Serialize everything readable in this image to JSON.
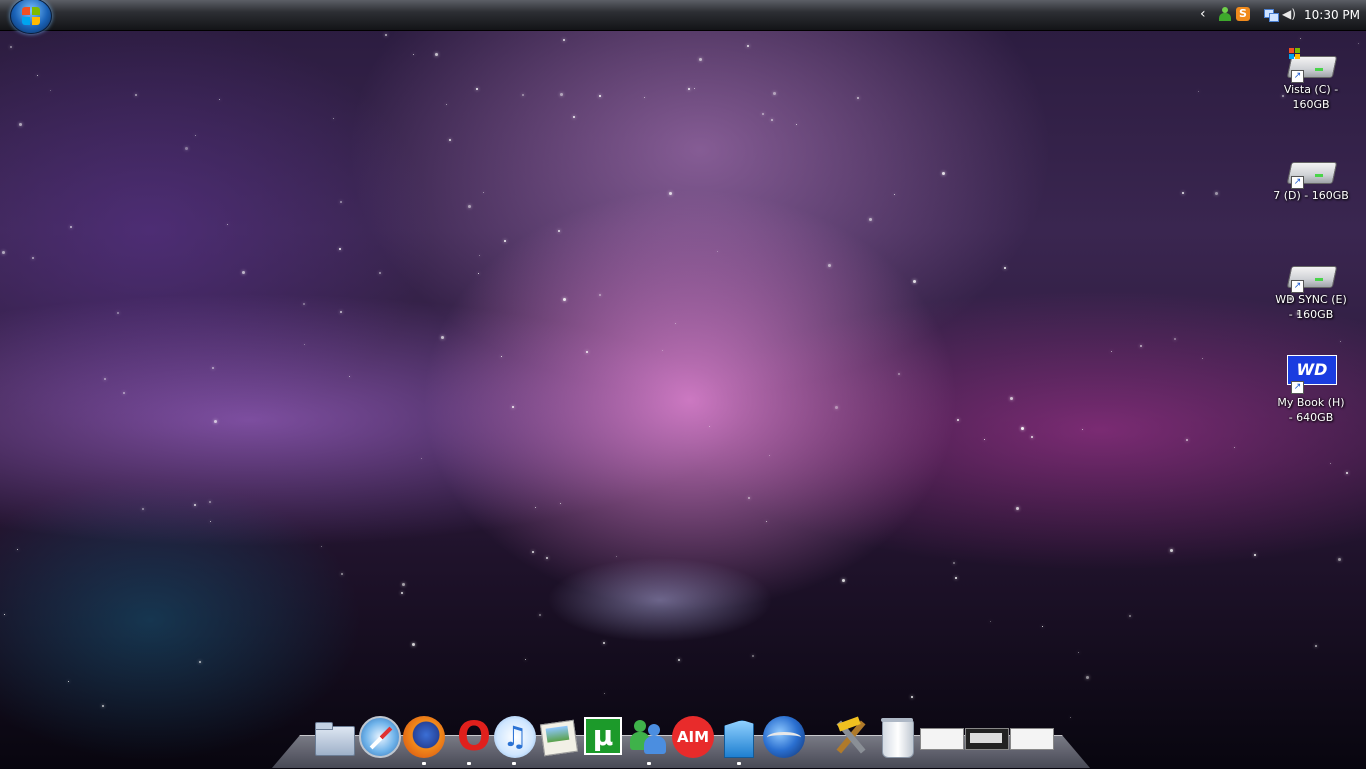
{
  "taskbar": {
    "clock": "10:30 PM",
    "tray_icons": [
      "chevron-left-icon",
      "user-icon",
      "skype-icon",
      "network-icon",
      "volume-icon"
    ]
  },
  "desktop_icons": [
    {
      "label_line1": "Vista (C) -",
      "label_line2": "160GB",
      "icon": "drive-icon"
    },
    {
      "label_line1": "7 (D) - 160GB",
      "label_line2": "",
      "icon": "drive-icon"
    },
    {
      "label_line1": "WD SYNC (E)",
      "label_line2": "- 160GB",
      "icon": "drive-icon"
    },
    {
      "label_line1": "My Book (H)",
      "label_line2": "- 640GB",
      "icon": "wd-drive-icon",
      "badge_text": "WD"
    }
  ],
  "dock": {
    "items": [
      {
        "icon": "folder-icon"
      },
      {
        "icon": "safari-icon"
      },
      {
        "icon": "firefox-icon"
      },
      {
        "icon": "opera-icon",
        "letter": "O"
      },
      {
        "icon": "itunes-icon",
        "letter": "♫"
      },
      {
        "icon": "image-viewer-icon"
      },
      {
        "icon": "utorrent-icon",
        "letter": "µ"
      },
      {
        "icon": "messenger-icon"
      },
      {
        "icon": "aim-icon",
        "text": "AIM"
      },
      {
        "icon": "document-icon"
      },
      {
        "icon": "google-earth-icon"
      },
      {
        "icon": "tools-icon"
      },
      {
        "icon": "recycle-bin-icon"
      },
      {
        "icon": "window-thumbnail-icon"
      },
      {
        "icon": "window-thumbnail-icon"
      },
      {
        "icon": "window-thumbnail-icon"
      }
    ]
  },
  "colors": {
    "dock_utorrent": "#1c9a2a",
    "dock_aim": "#e82b2b",
    "wd_badge": "#1a3ce0"
  }
}
